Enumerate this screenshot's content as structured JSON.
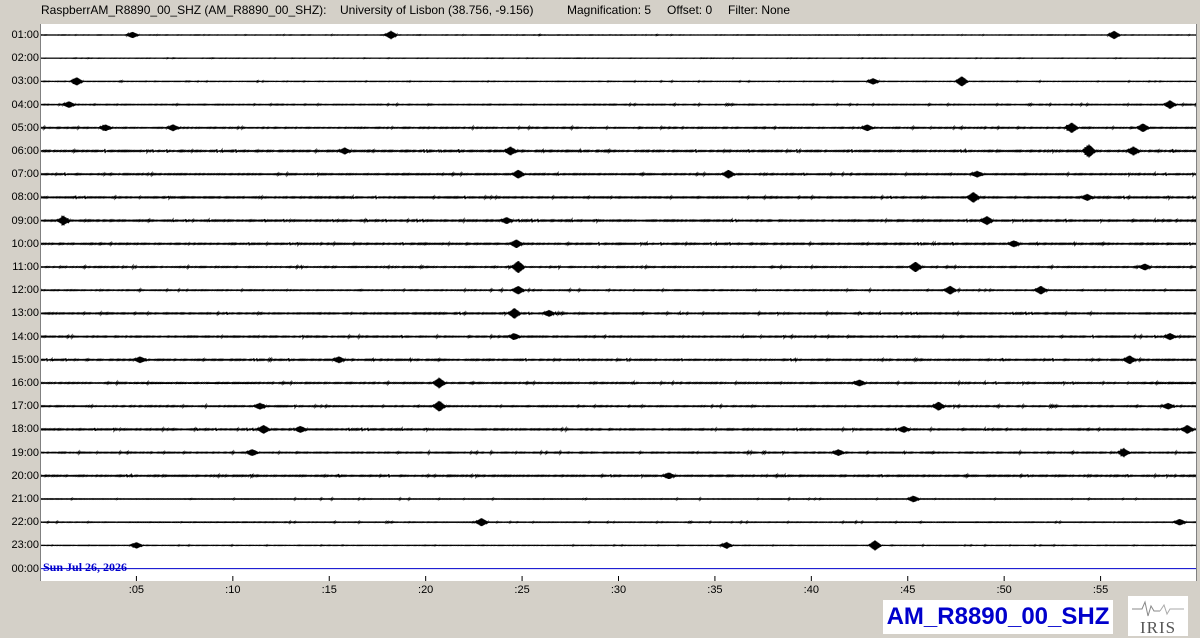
{
  "header": {
    "station": "RaspberrAM_R8890_00_SHZ (AM_R8890_00_SHZ):",
    "location": "University of Lisbon (38.756, -9.156)",
    "magnification": "Magnification: 5",
    "offset": "Offset: 0",
    "filter": "Filter: None"
  },
  "date_label": "Sun Jul 26, 2026",
  "station_badge": "AM_R8890_00_SHZ",
  "logo": {
    "text": "IRIS",
    "icon": "iris-logo-icon"
  },
  "colors": {
    "trace": "#000000",
    "last_trace": "#0000cc",
    "badge_text": "#0000cc",
    "background": "#d4d0c8"
  },
  "chart_data": {
    "type": "line",
    "subtype": "helicorder",
    "rows": [
      "01:00",
      "02:00",
      "03:00",
      "04:00",
      "05:00",
      "06:00",
      "07:00",
      "08:00",
      "09:00",
      "10:00",
      "11:00",
      "12:00",
      "13:00",
      "14:00",
      "15:00",
      "16:00",
      "17:00",
      "18:00",
      "19:00",
      "20:00",
      "21:00",
      "22:00",
      "23:00",
      "00:00"
    ],
    "x_ticks": [
      ":05",
      ":10",
      ":15",
      ":20",
      ":25",
      ":30",
      ":35",
      ":40",
      ":45",
      ":50",
      ":55"
    ],
    "x_tick_minutes": [
      5,
      10,
      15,
      20,
      25,
      30,
      35,
      40,
      45,
      50,
      55
    ],
    "xlim": [
      0,
      60
    ],
    "row_noise_level": [
      0.15,
      0.12,
      0.18,
      0.28,
      0.35,
      0.45,
      0.4,
      0.42,
      0.45,
      0.42,
      0.35,
      0.32,
      0.4,
      0.4,
      0.4,
      0.38,
      0.36,
      0.42,
      0.34,
      0.42,
      0.25,
      0.24,
      0.18,
      0
    ],
    "events": [
      {
        "row": 0,
        "minute": 4.8,
        "amp": 3
      },
      {
        "row": 0,
        "minute": 18.2,
        "amp": 4
      },
      {
        "row": 0,
        "minute": 55.7,
        "amp": 4
      },
      {
        "row": 2,
        "minute": 1.9,
        "amp": 4
      },
      {
        "row": 2,
        "minute": 43.2,
        "amp": 3
      },
      {
        "row": 2,
        "minute": 47.8,
        "amp": 5
      },
      {
        "row": 3,
        "minute": 1.5,
        "amp": 3
      },
      {
        "row": 3,
        "minute": 58.6,
        "amp": 4
      },
      {
        "row": 4,
        "minute": 3.4,
        "amp": 3
      },
      {
        "row": 4,
        "minute": 6.9,
        "amp": 3
      },
      {
        "row": 4,
        "minute": 42.9,
        "amp": 3
      },
      {
        "row": 4,
        "minute": 53.5,
        "amp": 5
      },
      {
        "row": 4,
        "minute": 57.2,
        "amp": 4
      },
      {
        "row": 5,
        "minute": 15.8,
        "amp": 3
      },
      {
        "row": 5,
        "minute": 24.4,
        "amp": 4
      },
      {
        "row": 5,
        "minute": 54.4,
        "amp": 6
      },
      {
        "row": 5,
        "minute": 56.7,
        "amp": 4
      },
      {
        "row": 6,
        "minute": 24.8,
        "amp": 4
      },
      {
        "row": 6,
        "minute": 35.7,
        "amp": 4
      },
      {
        "row": 6,
        "minute": 48.6,
        "amp": 3
      },
      {
        "row": 7,
        "minute": 48.4,
        "amp": 5
      },
      {
        "row": 7,
        "minute": 54.3,
        "amp": 3
      },
      {
        "row": 8,
        "minute": 1.2,
        "amp": 4
      },
      {
        "row": 8,
        "minute": 24.2,
        "amp": 3
      },
      {
        "row": 8,
        "minute": 49.1,
        "amp": 4
      },
      {
        "row": 9,
        "minute": 24.7,
        "amp": 4
      },
      {
        "row": 9,
        "minute": 50.5,
        "amp": 3
      },
      {
        "row": 10,
        "minute": 24.8,
        "amp": 6
      },
      {
        "row": 10,
        "minute": 45.4,
        "amp": 5
      },
      {
        "row": 10,
        "minute": 57.3,
        "amp": 3
      },
      {
        "row": 11,
        "minute": 24.8,
        "amp": 4
      },
      {
        "row": 11,
        "minute": 47.2,
        "amp": 4
      },
      {
        "row": 11,
        "minute": 51.9,
        "amp": 4
      },
      {
        "row": 12,
        "minute": 24.6,
        "amp": 5
      },
      {
        "row": 12,
        "minute": 26.4,
        "amp": 3
      },
      {
        "row": 13,
        "minute": 24.6,
        "amp": 3
      },
      {
        "row": 13,
        "minute": 58.6,
        "amp": 3
      },
      {
        "row": 14,
        "minute": 5.2,
        "amp": 3
      },
      {
        "row": 14,
        "minute": 15.5,
        "amp": 3
      },
      {
        "row": 14,
        "minute": 56.5,
        "amp": 4
      },
      {
        "row": 15,
        "minute": 20.7,
        "amp": 5
      },
      {
        "row": 15,
        "minute": 42.5,
        "amp": 3
      },
      {
        "row": 16,
        "minute": 11.4,
        "amp": 3
      },
      {
        "row": 16,
        "minute": 20.7,
        "amp": 5
      },
      {
        "row": 16,
        "minute": 46.6,
        "amp": 4
      },
      {
        "row": 16,
        "minute": 58.5,
        "amp": 3
      },
      {
        "row": 17,
        "minute": 11.6,
        "amp": 4
      },
      {
        "row": 17,
        "minute": 13.5,
        "amp": 3
      },
      {
        "row": 17,
        "minute": 44.8,
        "amp": 3
      },
      {
        "row": 17,
        "minute": 59.5,
        "amp": 4
      },
      {
        "row": 18,
        "minute": 11.0,
        "amp": 3
      },
      {
        "row": 18,
        "minute": 41.4,
        "amp": 3
      },
      {
        "row": 18,
        "minute": 56.2,
        "amp": 4
      },
      {
        "row": 19,
        "minute": 32.6,
        "amp": 3
      },
      {
        "row": 20,
        "minute": 45.3,
        "amp": 3
      },
      {
        "row": 21,
        "minute": 22.9,
        "amp": 4
      },
      {
        "row": 21,
        "minute": 59.1,
        "amp": 3
      },
      {
        "row": 22,
        "minute": 5.0,
        "amp": 3
      },
      {
        "row": 22,
        "minute": 35.6,
        "amp": 3
      },
      {
        "row": 22,
        "minute": 43.3,
        "amp": 5
      }
    ]
  }
}
